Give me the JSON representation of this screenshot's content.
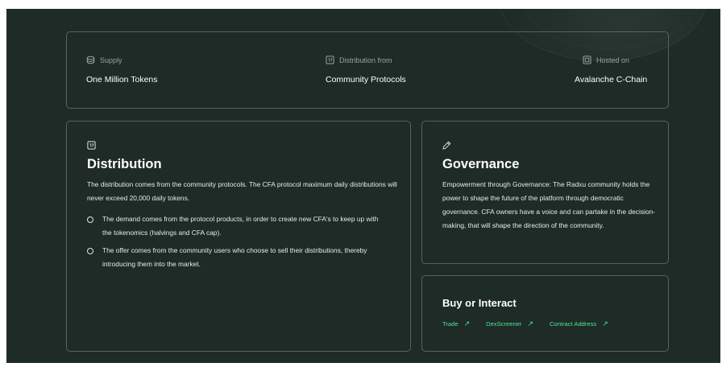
{
  "stats": [
    {
      "icon": "database-icon",
      "label": "Supply",
      "value": "One Million Tokens"
    },
    {
      "icon": "calendar-icon",
      "label": "Distribution from",
      "value": "Community Protocols"
    },
    {
      "icon": "square-icon",
      "label": "Hosted on",
      "value": "Avalanche C-Chain"
    }
  ],
  "distribution": {
    "icon": "calendar-icon",
    "title": "Distribution",
    "intro": "The distribution comes from the community protocols. The CFA protocol maximum daily distributions will never exceed 20,000 daily tokens.",
    "bullets": [
      "The demand comes from the protocol products, in order to create new CFA's to keep up with the tokenomics (halvings and CFA cap).",
      "The offer comes from the community users who choose to sell their distributions, thereby introducing them into the market."
    ]
  },
  "governance": {
    "icon": "pencil-icon",
    "title": "Governance",
    "text": "Empowerment through Governance: The Radxu community holds the power to shape the future of the platform through democratic governance. CFA owners have a voice and can partake in the decision-making, that will shape the direction of the community."
  },
  "buy": {
    "title": "Buy or Interact",
    "links": [
      "Trade",
      "DexScreener",
      "Contract Address"
    ],
    "arrow": "↗"
  },
  "colors": {
    "background": "#1e2b26",
    "border": "#56625d",
    "accent": "#4ee59a"
  }
}
